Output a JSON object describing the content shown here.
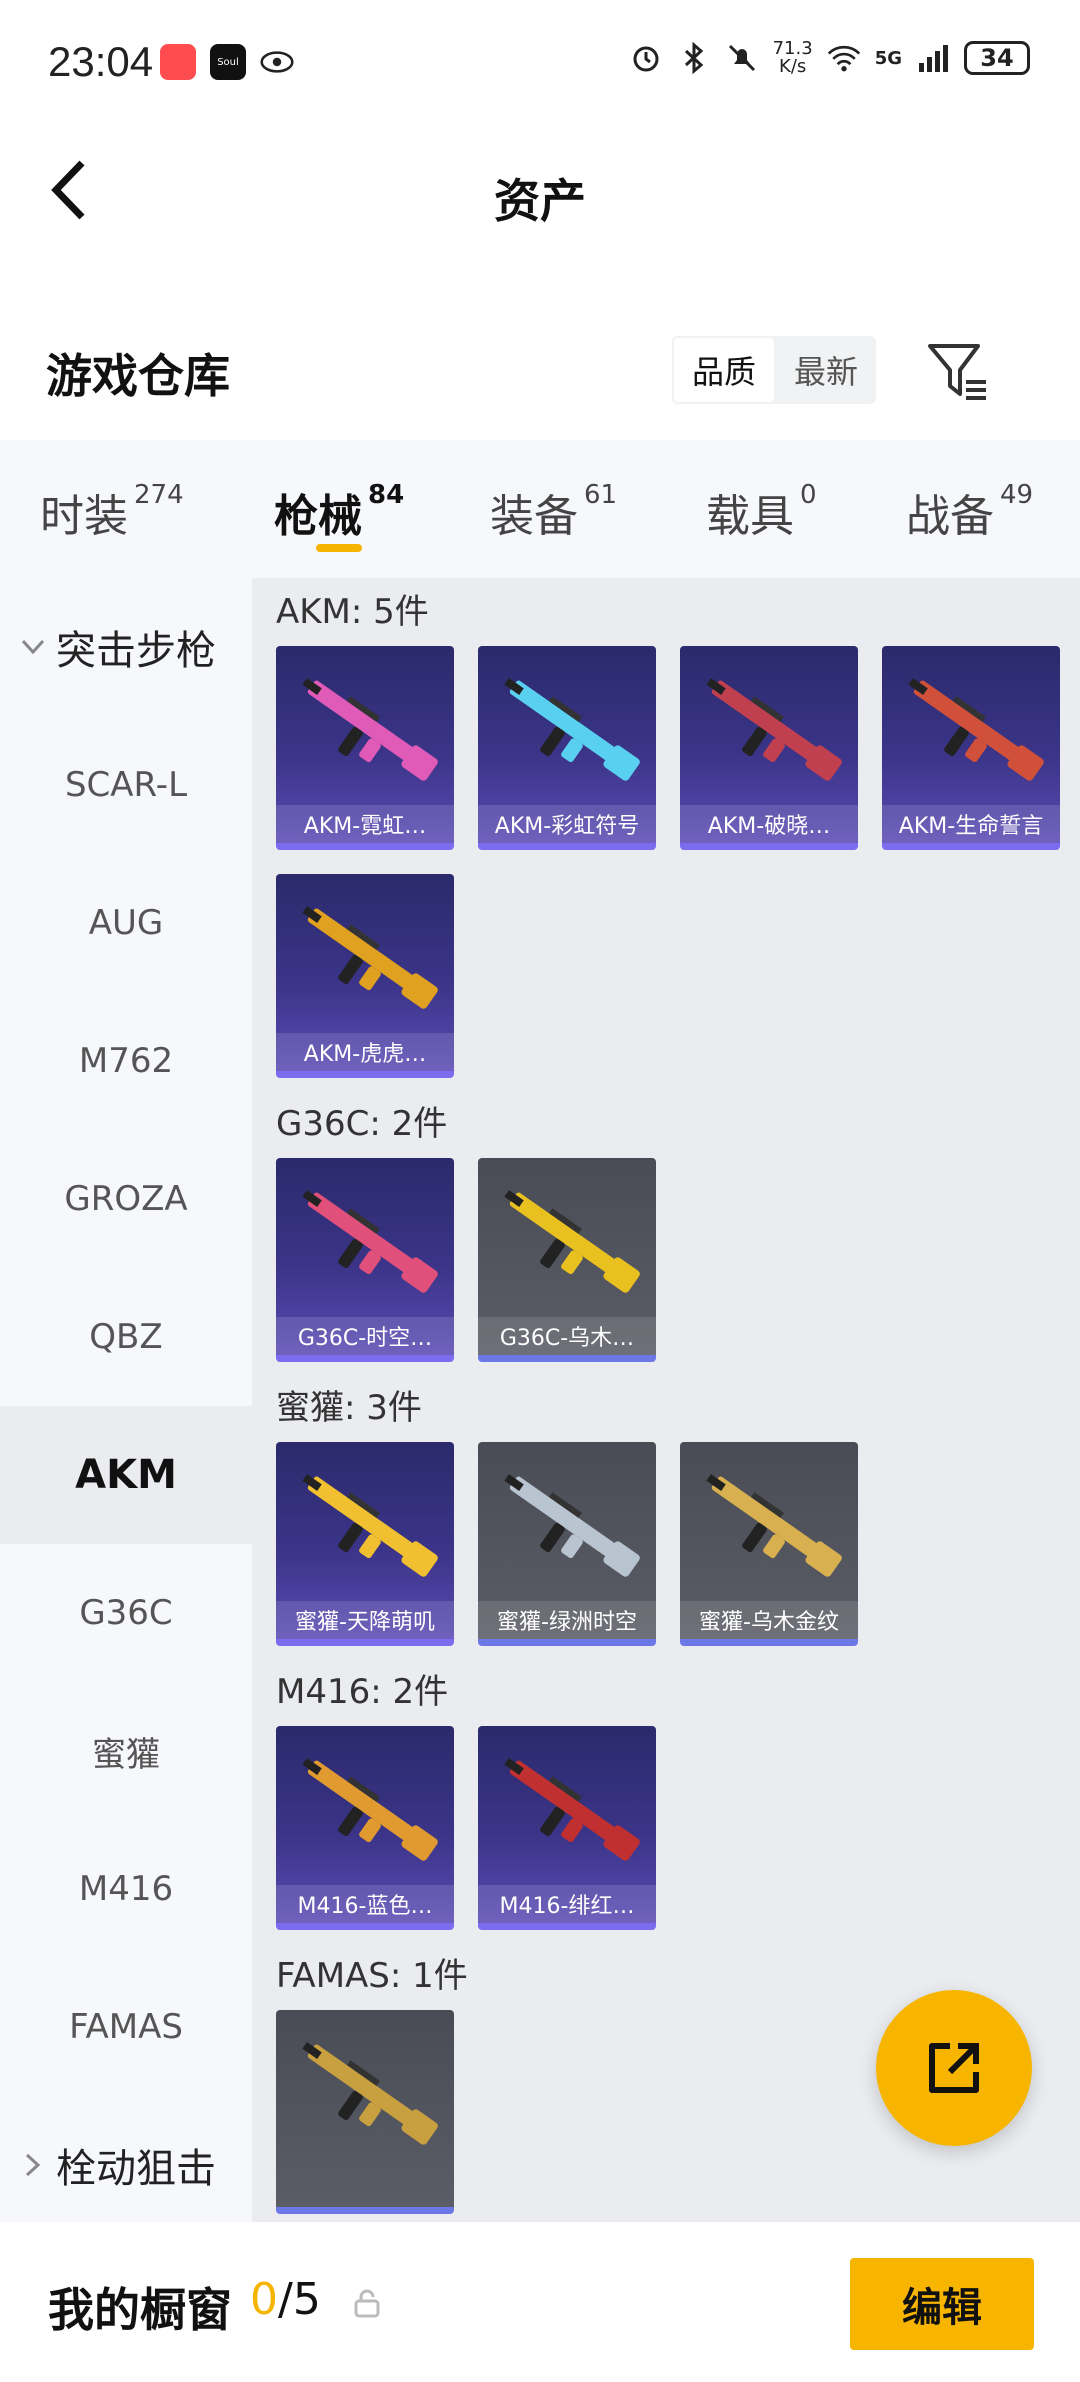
{
  "status_bar": {
    "time": "23:04",
    "app_icon_2": "Soul",
    "net_speed_value": "71.3",
    "net_speed_unit": "K/s",
    "network": "5G",
    "battery": "34"
  },
  "header": {
    "title": "资产"
  },
  "warehouse": {
    "title": "游戏仓库",
    "sort_options": [
      "品质",
      "最新"
    ],
    "active_sort": "品质"
  },
  "tabs": [
    {
      "label": "时装",
      "count": "274"
    },
    {
      "label": "枪械",
      "count": "84"
    },
    {
      "label": "装备",
      "count": "61"
    },
    {
      "label": "载具",
      "count": "0"
    },
    {
      "label": "战备",
      "count": "49"
    }
  ],
  "active_tab": "枪械",
  "sidebar": [
    {
      "label": "突击步枪",
      "type": "group-open"
    },
    {
      "label": "SCAR-L"
    },
    {
      "label": "AUG"
    },
    {
      "label": "M762"
    },
    {
      "label": "GROZA"
    },
    {
      "label": "QBZ"
    },
    {
      "label": "AKM",
      "active": true
    },
    {
      "label": "G36C"
    },
    {
      "label": "蜜獾"
    },
    {
      "label": "M416"
    },
    {
      "label": "FAMAS"
    },
    {
      "label": "栓动狙击",
      "type": "group-closed"
    }
  ],
  "sections": [
    {
      "title": "AKM: 5件",
      "items": [
        {
          "label": "AKM-霓虹…",
          "style": "purple",
          "gun_color": "#e05ab8"
        },
        {
          "label": "AKM-彩虹符号",
          "style": "purple",
          "gun_color": "#5ad0f0"
        },
        {
          "label": "AKM-破晓…",
          "style": "purple",
          "gun_color": "#c04050"
        },
        {
          "label": "AKM-生命誓言",
          "style": "purple",
          "gun_color": "#d0503a"
        },
        {
          "label": "AKM-虎虎…",
          "style": "purple",
          "gun_color": "#e0a020"
        }
      ]
    },
    {
      "title": "G36C: 2件",
      "items": [
        {
          "label": "G36C-时空…",
          "style": "purple",
          "gun_color": "#e0507a"
        },
        {
          "label": "G36C-乌木…",
          "style": "gray",
          "gun_color": "#e8c020"
        }
      ]
    },
    {
      "title": "蜜獾: 3件",
      "items": [
        {
          "label": "蜜獾-天降萌叽",
          "style": "purple",
          "gun_color": "#f0c030"
        },
        {
          "label": "蜜獾-绿洲时空",
          "style": "gray",
          "gun_color": "#b8c4d0"
        },
        {
          "label": "蜜獾-乌木金纹",
          "style": "gray",
          "gun_color": "#d8b050"
        }
      ]
    },
    {
      "title": "M416: 2件",
      "items": [
        {
          "label": "M416-蓝色…",
          "style": "purple",
          "gun_color": "#e09a30"
        },
        {
          "label": "M416-绯红…",
          "style": "purple",
          "gun_color": "#c03030"
        }
      ]
    },
    {
      "title": "FAMAS: 1件",
      "items": [
        {
          "label": "",
          "style": "gray",
          "gun_color": "#c8a040"
        }
      ]
    }
  ],
  "bottom_bar": {
    "title": "我的橱窗",
    "current": "0",
    "total": "/5",
    "edit_label": "编辑"
  },
  "colors": {
    "accent": "#f7b500",
    "card_purple": "#3b3488",
    "card_gray": "#5a5c66"
  }
}
